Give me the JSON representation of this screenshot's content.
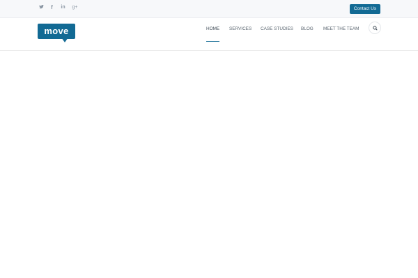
{
  "topbar": {
    "social": [
      {
        "name": "twitter-icon",
        "glyph": "🐦"
      },
      {
        "name": "facebook-icon",
        "glyph": "f"
      },
      {
        "name": "linkedin-icon",
        "glyph": "in"
      },
      {
        "name": "google-plus-icon",
        "glyph": "g+"
      }
    ],
    "contact_label": "Contact Us"
  },
  "header": {
    "logo_text": "move",
    "nav": [
      {
        "label": "HOME",
        "active": true
      },
      {
        "label": "SERVICES",
        "active": false
      },
      {
        "label": "CASE STUDIES",
        "active": false
      },
      {
        "label": "BLOG",
        "active": false
      },
      {
        "label": "MEET THE TEAM",
        "active": false
      }
    ],
    "search_icon": "search-icon"
  },
  "colors": {
    "accent": "#126a94",
    "topbar_bg": "#f7f8fa",
    "nav_text": "#5b6670"
  }
}
